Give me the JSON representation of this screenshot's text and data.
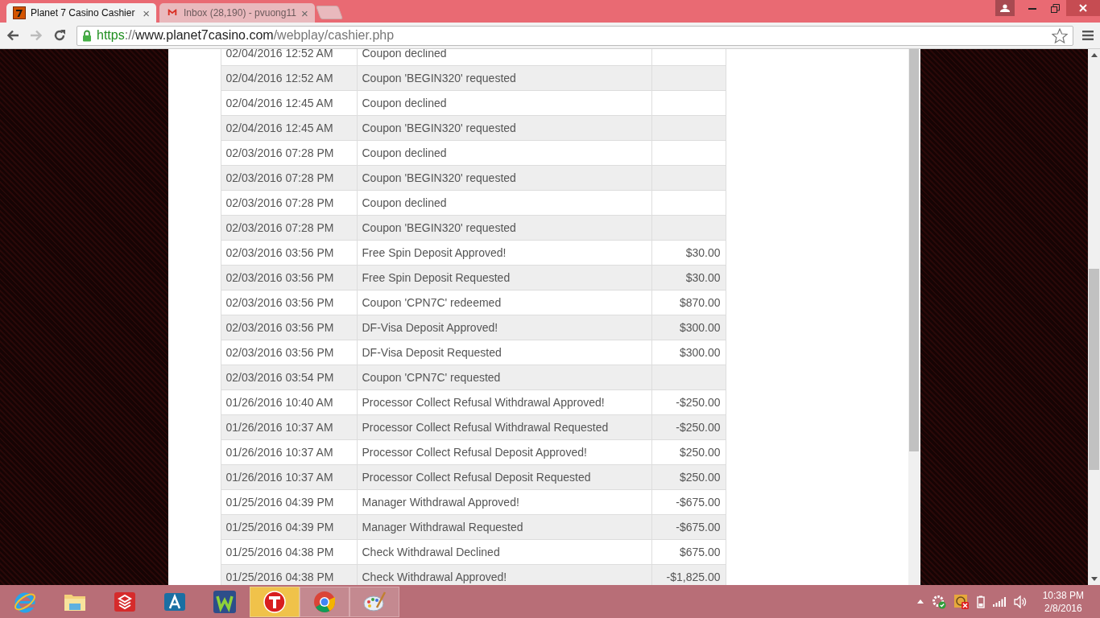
{
  "tabs": [
    {
      "title": "Planet 7 Casino Cashier",
      "selected": true,
      "close": "×"
    },
    {
      "title": "Inbox (28,190) - pvuong11",
      "selected": false,
      "close": "×"
    }
  ],
  "address": {
    "scheme": "https",
    "separator": "://",
    "host": "www.planet7casino.com",
    "path": "/webplay/cashier.php"
  },
  "transactions": [
    {
      "date": "02/04/2016 12:52 AM",
      "description": "Coupon declined"
    },
    {
      "date": "02/04/2016 12:52 AM",
      "description": "Coupon 'BEGIN320' requested"
    },
    {
      "date": "02/04/2016 12:45 AM",
      "description": "Coupon declined"
    },
    {
      "date": "02/04/2016 12:45 AM",
      "description": "Coupon 'BEGIN320' requested"
    },
    {
      "date": "02/03/2016 07:28 PM",
      "description": "Coupon declined"
    },
    {
      "date": "02/03/2016 07:28 PM",
      "description": "Coupon 'BEGIN320' requested"
    },
    {
      "date": "02/03/2016 07:28 PM",
      "description": "Coupon declined"
    },
    {
      "date": "02/03/2016 07:28 PM",
      "description": "Coupon 'BEGIN320' requested"
    },
    {
      "date": "02/03/2016 03:56 PM",
      "description": "Free Spin Deposit Approved!",
      "amount": "$30.00"
    },
    {
      "date": "02/03/2016 03:56 PM",
      "description": "Free Spin Deposit Requested",
      "amount": "$30.00"
    },
    {
      "date": "02/03/2016 03:56 PM",
      "description": "Coupon 'CPN7C' redeemed",
      "amount": "$870.00"
    },
    {
      "date": "02/03/2016 03:56 PM",
      "description": "DF-Visa Deposit Approved!",
      "amount": "$300.00"
    },
    {
      "date": "02/03/2016 03:56 PM",
      "description": "DF-Visa Deposit Requested",
      "amount": "$300.00"
    },
    {
      "date": "02/03/2016 03:54 PM",
      "description": "Coupon 'CPN7C' requested"
    },
    {
      "date": "01/26/2016 10:40 AM",
      "description": "Processor Collect Refusal Withdrawal Approved!",
      "amount": "-$250.00"
    },
    {
      "date": "01/26/2016 10:37 AM",
      "description": "Processor Collect Refusal Withdrawal Requested",
      "amount": "-$250.00"
    },
    {
      "date": "01/26/2016 10:37 AM",
      "description": "Processor Collect Refusal Deposit Approved!",
      "amount": "$250.00"
    },
    {
      "date": "01/26/2016 10:37 AM",
      "description": "Processor Collect Refusal Deposit Requested",
      "amount": "$250.00"
    },
    {
      "date": "01/25/2016 04:39 PM",
      "description": "Manager Withdrawal Approved!",
      "amount": "-$675.00"
    },
    {
      "date": "01/25/2016 04:39 PM",
      "description": "Manager Withdrawal Requested",
      "amount": "-$675.00"
    },
    {
      "date": "01/25/2016 04:38 PM",
      "description": "Check Withdrawal Declined",
      "amount": "$675.00"
    },
    {
      "date": "01/25/2016 04:38 PM",
      "description": "Check Withdrawal Approved!",
      "amount": "-$1,825.00"
    }
  ],
  "taskbar": [
    {
      "active": false,
      "running": false
    },
    {
      "active": false,
      "running": false
    },
    {
      "active": false,
      "running": false
    },
    {
      "active": false,
      "running": false
    },
    {
      "active": false,
      "running": false
    },
    {
      "active": true,
      "running": true
    },
    {
      "active": false,
      "running": true
    },
    {
      "active": false,
      "running": true
    }
  ],
  "clock": {
    "time": "10:38 PM",
    "date": "2/8/2016"
  }
}
